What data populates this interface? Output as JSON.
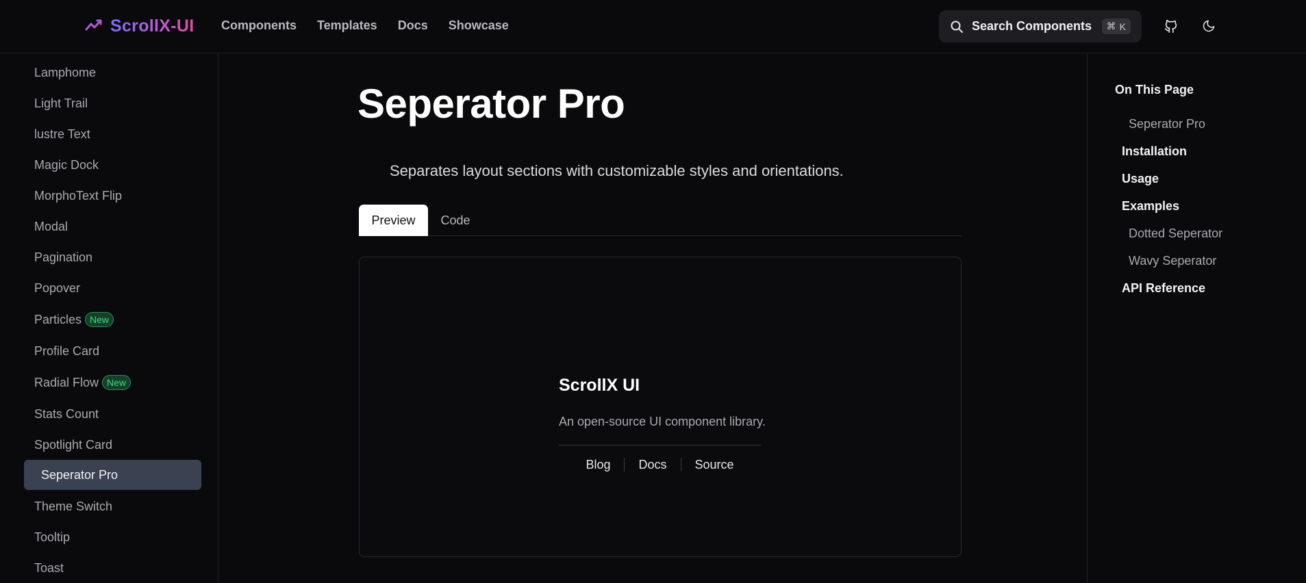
{
  "header": {
    "logo_text": "ScrollX-UI",
    "nav": [
      "Components",
      "Templates",
      "Docs",
      "Showcase"
    ],
    "search": {
      "label": "Search Components",
      "shortcut_symbol": "⌘",
      "shortcut_key": "K"
    }
  },
  "sidebar": {
    "items": [
      {
        "label": "Lamphome"
      },
      {
        "label": "Light Trail"
      },
      {
        "label": "lustre Text"
      },
      {
        "label": "Magic Dock"
      },
      {
        "label": "MorphoText Flip"
      },
      {
        "label": "Modal"
      },
      {
        "label": "Pagination"
      },
      {
        "label": "Popover"
      },
      {
        "label": "Particles",
        "badge": "New"
      },
      {
        "label": "Profile Card"
      },
      {
        "label": "Radial Flow",
        "badge": "New"
      },
      {
        "label": "Stats Count"
      },
      {
        "label": "Spotlight Card"
      },
      {
        "label": "Seperator Pro",
        "active": true
      },
      {
        "label": "Theme Switch"
      },
      {
        "label": "Tooltip"
      },
      {
        "label": "Toast"
      }
    ]
  },
  "main": {
    "title": "Seperator Pro",
    "description": "Separates layout sections with customizable styles and orientations.",
    "tabs": [
      "Preview",
      "Code"
    ],
    "preview": {
      "title": "ScrollX UI",
      "subtitle": "An open-source UI component library.",
      "links": [
        "Blog",
        "Docs",
        "Source"
      ]
    }
  },
  "toc": {
    "heading": "On This Page",
    "items": [
      {
        "label": "Seperator Pro",
        "level": 2
      },
      {
        "label": "Installation",
        "level": 1
      },
      {
        "label": "Usage",
        "level": 1
      },
      {
        "label": "Examples",
        "level": 1
      },
      {
        "label": "Dotted Seperator",
        "level": 2
      },
      {
        "label": "Wavy Seperator",
        "level": 2
      },
      {
        "label": "API Reference",
        "level": 1
      }
    ]
  },
  "colors": {
    "background": "#0a0a0c",
    "accent_purple": "#7c6cf6",
    "accent_pink": "#e04d9a",
    "badge_green": "#3fdc7a",
    "active_item_bg": "#3a4150"
  },
  "icons": [
    "logo-chart-icon",
    "search-icon",
    "github-icon",
    "moon-icon"
  ]
}
